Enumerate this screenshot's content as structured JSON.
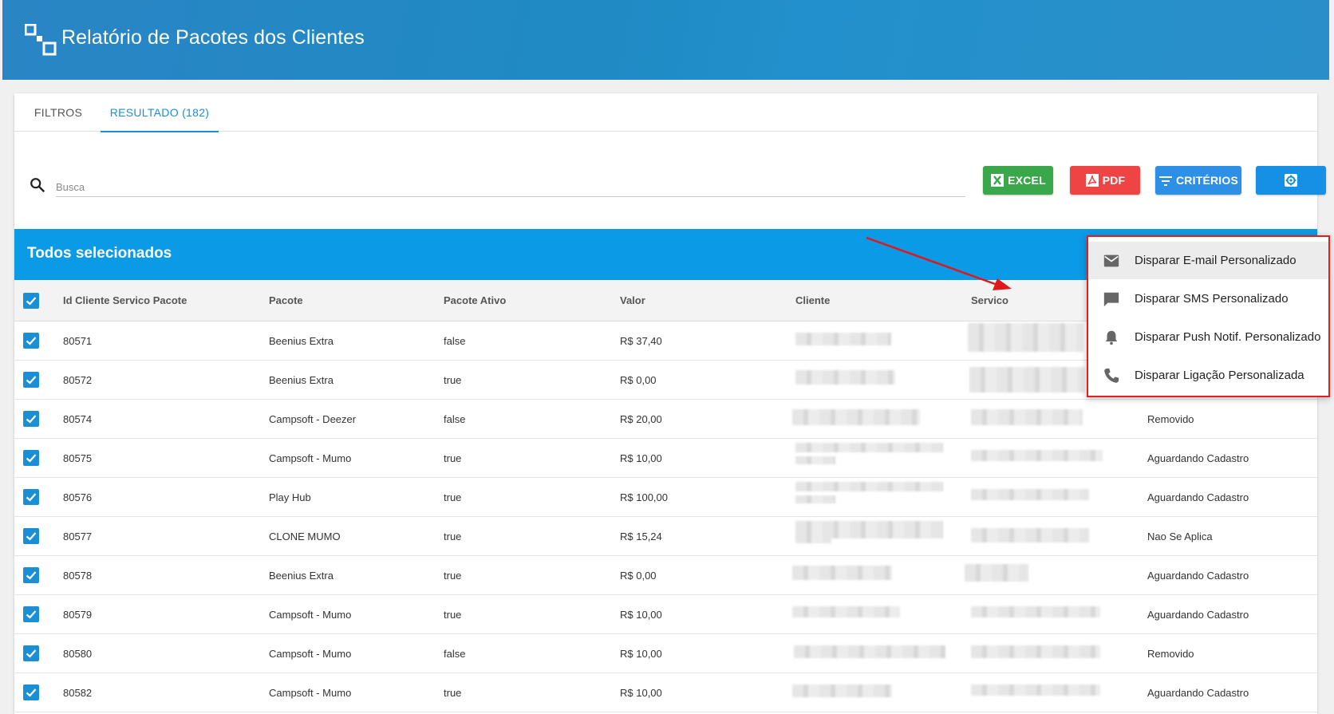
{
  "header": {
    "title": "Relatório de Pacotes dos Clientes"
  },
  "tabs": [
    {
      "label": "FILTROS"
    },
    {
      "label": "RESULTADO (182)"
    }
  ],
  "search": {
    "placeholder": "Busca"
  },
  "toolbar": {
    "excel_label": "EXCEL",
    "pdf_label": "PDF",
    "criteria_label": "CRITÉRIOS"
  },
  "selection": {
    "label": "Todos selecionados"
  },
  "table": {
    "headers": [
      "Id Cliente Servico Pacote",
      "Pacote",
      "Pacote Ativo",
      "Valor",
      "Cliente",
      "Servico"
    ],
    "rows": [
      {
        "id": "80571",
        "pacote": "Beenius Extra",
        "ativo": "false",
        "valor": "R$ 37,40",
        "status": ""
      },
      {
        "id": "80572",
        "pacote": "Beenius Extra",
        "ativo": "true",
        "valor": "R$ 0,00",
        "status": ""
      },
      {
        "id": "80574",
        "pacote": "Campsoft - Deezer",
        "ativo": "false",
        "valor": "R$ 20,00",
        "status": "Removido"
      },
      {
        "id": "80575",
        "pacote": "Campsoft - Mumo",
        "ativo": "true",
        "valor": "R$ 10,00",
        "status": "Aguardando Cadastro"
      },
      {
        "id": "80576",
        "pacote": "Play Hub",
        "ativo": "true",
        "valor": "R$ 100,00",
        "status": "Aguardando Cadastro"
      },
      {
        "id": "80577",
        "pacote": "CLONE MUMO",
        "ativo": "true",
        "valor": "R$ 15,24",
        "status": "Nao Se Aplica"
      },
      {
        "id": "80578",
        "pacote": "Beenius Extra",
        "ativo": "true",
        "valor": "R$ 0,00",
        "status": "Aguardando Cadastro"
      },
      {
        "id": "80579",
        "pacote": "Campsoft - Mumo",
        "ativo": "true",
        "valor": "R$ 10,00",
        "status": "Aguardando Cadastro"
      },
      {
        "id": "80580",
        "pacote": "Campsoft - Mumo",
        "ativo": "false",
        "valor": "R$ 10,00",
        "status": "Removido"
      },
      {
        "id": "80582",
        "pacote": "Campsoft - Mumo",
        "ativo": "true",
        "valor": "R$ 10,00",
        "status": "Aguardando Cadastro"
      }
    ]
  },
  "menu": {
    "items": [
      {
        "label": "Disparar E-mail Personalizado",
        "icon": "email-icon"
      },
      {
        "label": "Disparar SMS Personalizado",
        "icon": "chat-icon"
      },
      {
        "label": "Disparar Push Notif. Personalizado",
        "icon": "bell-icon"
      },
      {
        "label": "Disparar Ligação Personalizada",
        "icon": "phone-icon"
      }
    ]
  },
  "colors": {
    "header": "#2a85c5",
    "accent": "#1a8fd6",
    "selection_bar": "#0b9ae6",
    "excel": "#3aa84a",
    "pdf": "#ef4444",
    "criteria": "#2e8fe6",
    "highlight": "#e02020"
  }
}
